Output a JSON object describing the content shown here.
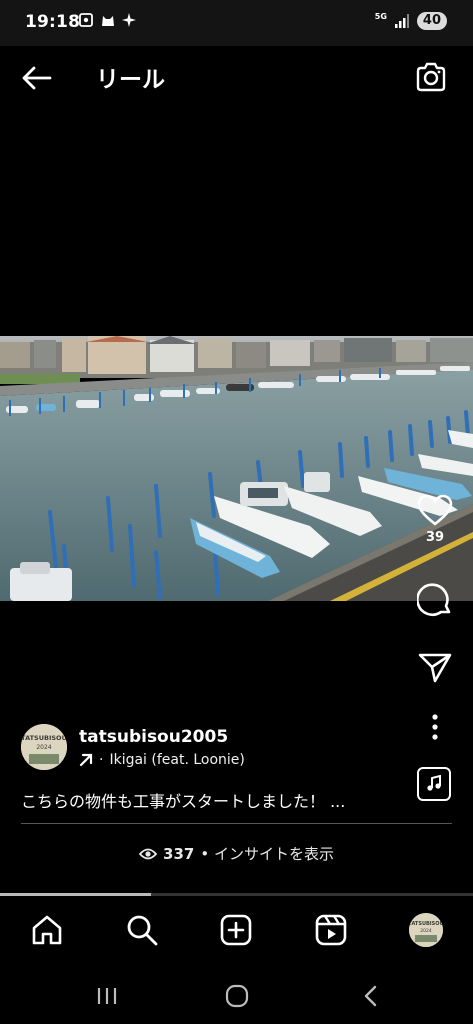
{
  "status_bar": {
    "time": "19:18",
    "network": "5G",
    "battery": "40"
  },
  "header": {
    "title": "リール",
    "back_icon": "arrow-left-icon",
    "camera_icon": "camera-icon"
  },
  "reel": {
    "likes": "39",
    "progress": 0.32
  },
  "author": {
    "username": "tatsubisou2005",
    "avatar_text": "TATSUBISOU",
    "avatar_year": "2024"
  },
  "music": {
    "separator": "·",
    "track": "Ikigai (feat. Loonie)"
  },
  "caption": {
    "text": "こちらの物件も工事がスタートしました！ ..."
  },
  "insights": {
    "count": "337",
    "label": "• インサイトを表示"
  },
  "nav": {
    "items": [
      "home-icon",
      "search-icon",
      "create-icon",
      "reels-icon",
      "profile-avatar"
    ]
  },
  "colors": {
    "background": "#000000",
    "status_bar": "#141414",
    "water": "#6f8a8f",
    "boat_blue": "#6fb3d8",
    "pole_blue": "#2e6fb8"
  }
}
